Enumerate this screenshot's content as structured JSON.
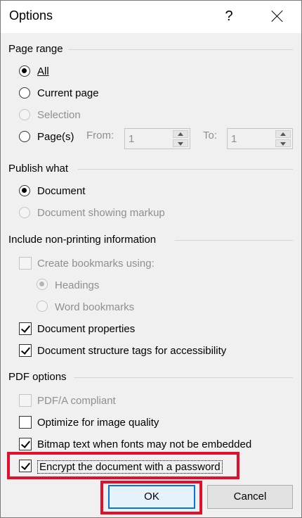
{
  "window": {
    "title": "Options",
    "help": "?"
  },
  "page_range": {
    "title": "Page range",
    "all": "All",
    "current_page": "Current page",
    "selection": "Selection",
    "pages": "Page(s)",
    "from_label": "From:",
    "from_value": "1",
    "to_label": "To:",
    "to_value": "1"
  },
  "publish_what": {
    "title": "Publish what",
    "document": "Document",
    "document_markup": "Document showing markup"
  },
  "non_printing": {
    "title": "Include non-printing information",
    "create_bookmarks": "Create bookmarks using:",
    "headings": "Headings",
    "word_bookmarks": "Word bookmarks",
    "doc_properties": "Document properties",
    "structure_tags": "Document structure tags for accessibility"
  },
  "pdf_options": {
    "title": "PDF options",
    "pdfa": "PDF/A compliant",
    "optimize": "Optimize for image quality",
    "bitmap": "Bitmap text when fonts may not be embedded",
    "encrypt": "Encrypt the document with a password"
  },
  "buttons": {
    "ok": "OK",
    "cancel": "Cancel"
  },
  "colors": {
    "highlight": "#e0102a",
    "default_button_border": "#0078d7"
  }
}
